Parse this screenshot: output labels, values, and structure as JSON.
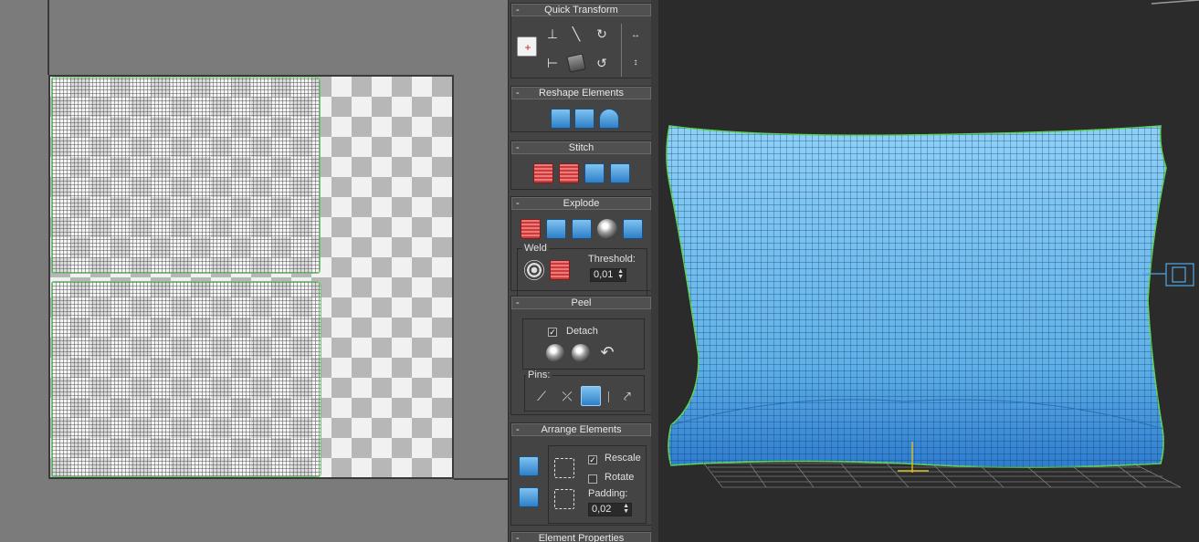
{
  "uv_editor": {
    "islands": [
      "top",
      "bottom"
    ]
  },
  "panel": {
    "quick_transform": {
      "title": "Quick Transform",
      "collapse": "-"
    },
    "reshape_elements": {
      "title": "Reshape Elements",
      "collapse": "-"
    },
    "stitch": {
      "title": "Stitch",
      "collapse": "-"
    },
    "explode": {
      "title": "Explode",
      "collapse": "-",
      "weld_label": "Weld",
      "threshold_label": "Threshold:",
      "threshold_value": "0,01"
    },
    "peel": {
      "title": "Peel",
      "collapse": "-",
      "detach_label": "Detach",
      "detach_checked": true,
      "pins_label": "Pins:"
    },
    "arrange_elements": {
      "title": "Arrange Elements",
      "collapse": "-",
      "rescale_label": "Rescale",
      "rescale_checked": true,
      "rotate_label": "Rotate",
      "rotate_checked": false,
      "padding_label": "Padding:",
      "padding_value": "0,02"
    },
    "element_properties": {
      "title": "Element Properties",
      "collapse": "-"
    }
  },
  "colors": {
    "uv_bg": "#7b7b7b",
    "panel_bg": "#444444",
    "viewport_bg": "#2b2b2b",
    "mesh_blue": "#4ea8e6",
    "selection_green": "#5ed35e",
    "gizmo_yellow": "#d8c020"
  }
}
